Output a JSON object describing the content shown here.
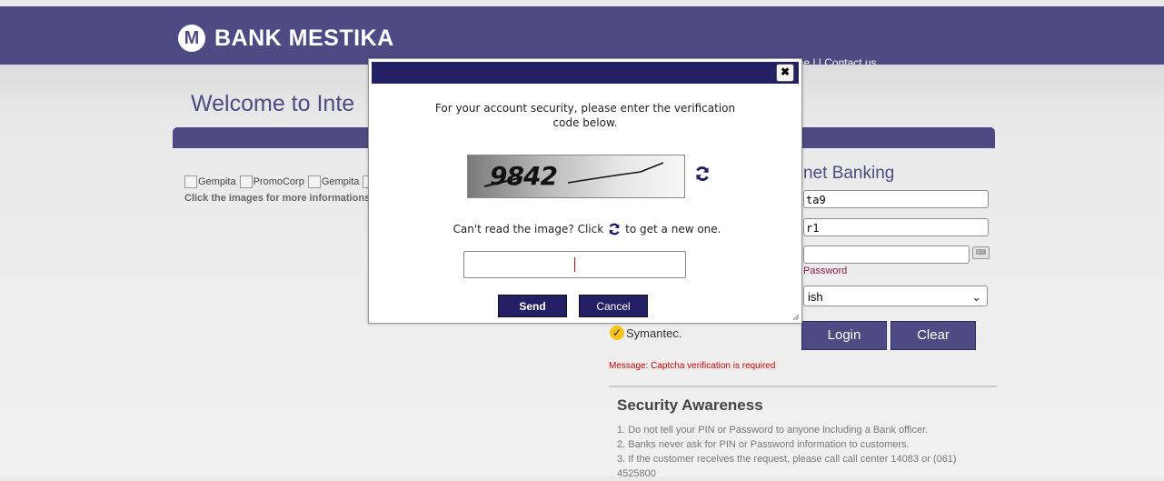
{
  "brand": {
    "logo_letter": "M",
    "name": "BANK MESTIKA"
  },
  "toplinks": {
    "home": "Home",
    "separator": " | | ",
    "contact": "Contact us"
  },
  "welcome": "Welcome to Inte",
  "promo": {
    "images": [
      {
        "alt": "Gempita"
      },
      {
        "alt": "PromoCorp"
      },
      {
        "alt": "Gempita"
      },
      {
        "alt": ""
      }
    ],
    "info": "Click the images for more informations"
  },
  "login": {
    "title": "net Banking",
    "user_value": "ta9",
    "company_value": "r1",
    "password_value": "",
    "forgot": "Password",
    "language": "ish",
    "login_button": "Login",
    "clear_button": "Clear"
  },
  "symantec": "Symantec.",
  "message": "Message: Captcha verification is required",
  "security": {
    "title": "Security Awareness",
    "items": [
      "1. Do not tell your PIN or Password to anyone including a Bank officer.",
      "2. Banks never ask for PIN or Password information to customers.",
      "3. If the customer receives the request, please call call center 14083 or (061) 4525800"
    ]
  },
  "modal": {
    "close": "✖",
    "prompt": "For your account security, please enter the verification code below.",
    "captcha_text": "9842",
    "cant_read_before": "Can't read the image? Click",
    "cant_read_after": "to get a new one.",
    "code_value": "",
    "send": "Send",
    "cancel": "Cancel"
  },
  "colors": {
    "brand": "#4e4a84",
    "modal_bar": "#232066",
    "message": "#d40000"
  }
}
